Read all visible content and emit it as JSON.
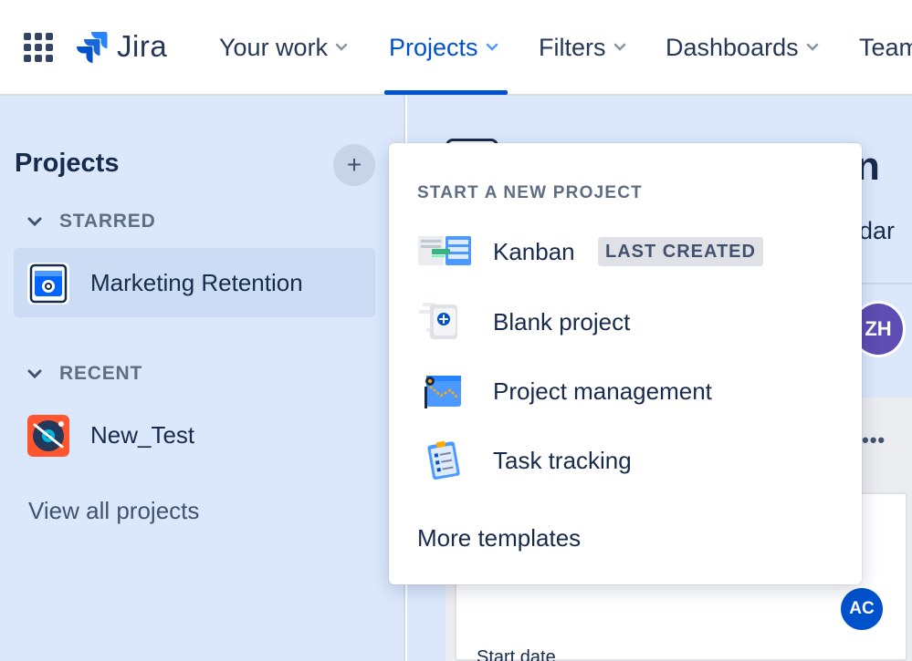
{
  "app": {
    "name": "Jira"
  },
  "nav": {
    "items": [
      {
        "label": "Your work"
      },
      {
        "label": "Projects"
      },
      {
        "label": "Filters"
      },
      {
        "label": "Dashboards"
      },
      {
        "label": "Team"
      }
    ],
    "active": "Projects",
    "accent_color": "#0052cc"
  },
  "sidebar": {
    "title": "Projects",
    "add_label": "+",
    "sections": [
      {
        "label": "STARRED",
        "items": [
          {
            "label": "Marketing Retention",
            "icon": "marketing-retention-project-icon"
          }
        ]
      },
      {
        "label": "RECENT",
        "items": [
          {
            "label": "New_Test",
            "icon": "new-test-project-icon"
          }
        ]
      }
    ],
    "view_all_label": "View all projects"
  },
  "main": {
    "title_fragment": "n",
    "tab_fragment": "dar",
    "avatar_top": {
      "initials": "ZH",
      "color": "#5e4db2"
    },
    "more_label": "•••",
    "avatar_card": {
      "initials": "AC",
      "color": "#0052cc"
    },
    "field_label": "Start date"
  },
  "dropdown": {
    "heading": "START A NEW PROJECT",
    "templates": [
      {
        "label": "Kanban",
        "badge": "LAST CREATED",
        "icon": "kanban-template-icon"
      },
      {
        "label": "Blank project",
        "icon": "blank-project-template-icon"
      },
      {
        "label": "Project management",
        "icon": "project-management-template-icon"
      },
      {
        "label": "Task tracking",
        "icon": "task-tracking-template-icon"
      }
    ],
    "more_label": "More templates"
  }
}
